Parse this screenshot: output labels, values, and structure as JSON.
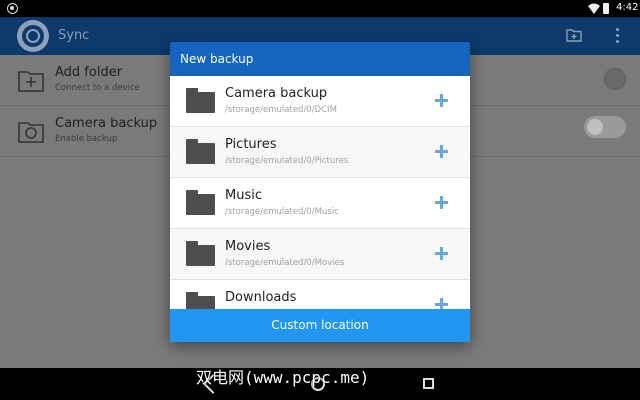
{
  "status_bar": {
    "time": "4:42"
  },
  "app_bar": {
    "title": "Sync"
  },
  "background_list": [
    {
      "title": "Add folder",
      "subtitle": "Connect to a device"
    },
    {
      "title": "Camera backup",
      "subtitle": "Enable backup"
    }
  ],
  "dialog": {
    "title": "New backup",
    "folders": [
      {
        "name": "Camera backup",
        "path": "/storage/emulated/0/DCIM"
      },
      {
        "name": "Pictures",
        "path": "/storage/emulated/0/Pictures"
      },
      {
        "name": "Music",
        "path": "/storage/emulated/0/Music"
      },
      {
        "name": "Movies",
        "path": "/storage/emulated/0/Movies"
      },
      {
        "name": "Downloads",
        "path": ""
      }
    ],
    "custom_location_label": "Custom location"
  },
  "watermark": "双电网(www.pcpc.me)",
  "colors": {
    "dialog_header": "#1565c0",
    "dialog_footer": "#2196f3",
    "plus_icon": "#6da6dd",
    "folder_icon": "#4e4e50"
  }
}
